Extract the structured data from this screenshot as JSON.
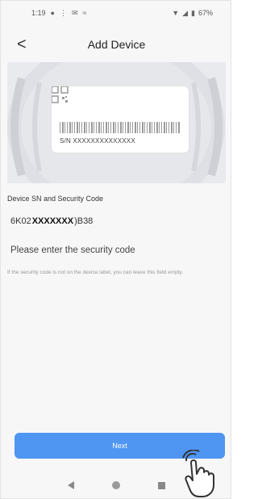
{
  "status_bar": {
    "time": "1:19",
    "icons_left": [
      "location-pin-icon",
      "signal-dots-icon",
      "message-icon",
      "cast-icon"
    ],
    "battery": "67%"
  },
  "header": {
    "title": "Add Device",
    "back_label": "<"
  },
  "hero": {
    "serial_label": "S/N XXXXXXXXXXXXXX"
  },
  "form": {
    "field_label": "Device SN and Security Code",
    "serial_prefix": "6K02",
    "serial_mask": "XXXXXXX",
    "serial_suffix": ")B38",
    "security_placeholder": "Please enter the security code",
    "hint": "If the security code is not on the device label, you can leave this field empty."
  },
  "actions": {
    "next_label": "Next"
  },
  "colors": {
    "accent": "#4f95f2",
    "background": "#f7f7f8"
  }
}
